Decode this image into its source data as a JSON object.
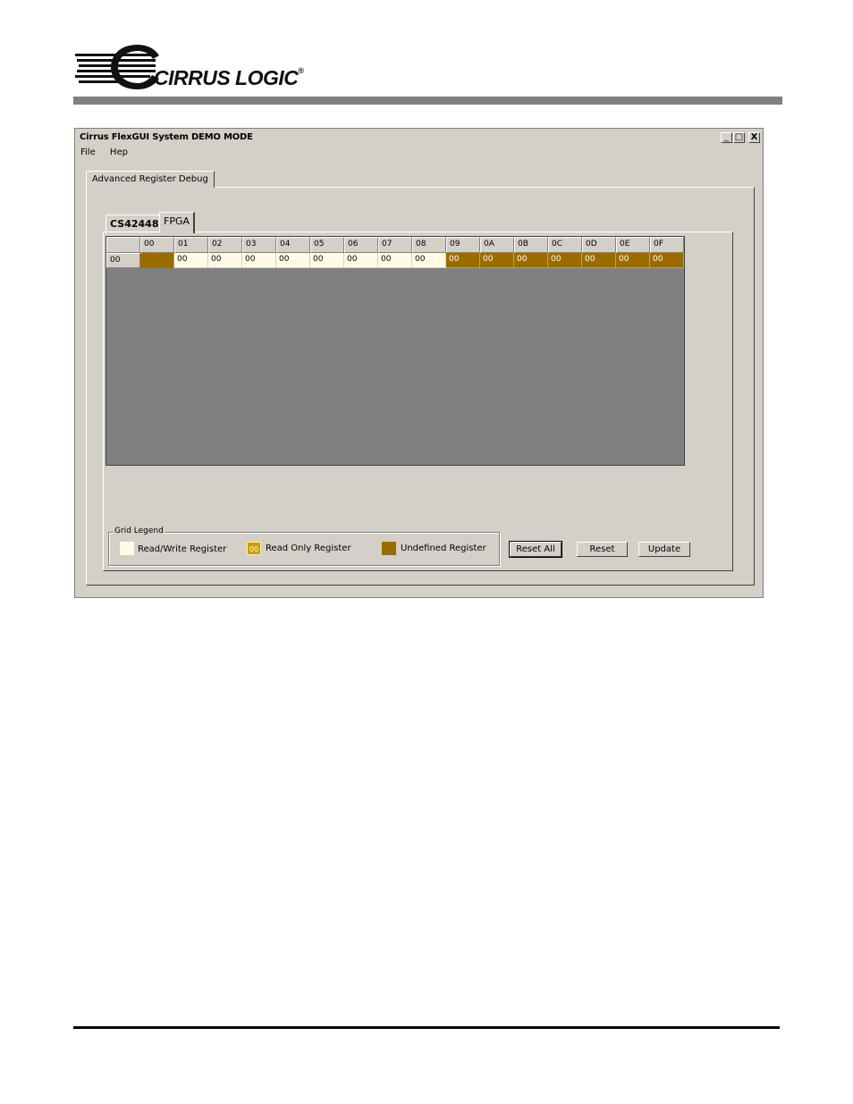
{
  "brand": {
    "name": "CIRRUS LOGIC",
    "reg_mark": "®"
  },
  "window": {
    "title": "Cirrus FlexGUI System DEMO MODE",
    "controls": {
      "minimize": "_",
      "maximize": "□",
      "close": "X"
    }
  },
  "menu": {
    "file": "File",
    "help": "Hep"
  },
  "outer_tab": {
    "label": "Advanced Register Debug"
  },
  "inner_tabs": {
    "tab1": "CS42448",
    "tab2": "FPGA"
  },
  "grid": {
    "columns": [
      "00",
      "01",
      "02",
      "03",
      "04",
      "05",
      "06",
      "07",
      "08",
      "09",
      "0A",
      "0B",
      "0C",
      "0D",
      "0E",
      "0F"
    ],
    "row_header": "00",
    "cells": [
      "",
      "00",
      "00",
      "00",
      "00",
      "00",
      "00",
      "00",
      "00",
      "00",
      "00",
      "00",
      "00",
      "00",
      "00",
      "00"
    ],
    "cell_types": [
      "undefined",
      "rw",
      "rw",
      "rw",
      "rw",
      "rw",
      "rw",
      "rw",
      "rw",
      "ro",
      "ro",
      "ro",
      "ro",
      "ro",
      "ro",
      "ro"
    ]
  },
  "legend": {
    "title": "Grid Legend",
    "rw_label": "Read/Write Register",
    "ro_label": "Read Only Register",
    "ro_swatch": "00",
    "ud_label": "Undefined Register"
  },
  "buttons": {
    "reset_all": "Reset All",
    "reset": "Reset",
    "update": "Update"
  },
  "colors": {
    "read_write": "#fffbe6",
    "read_only": "#9a6c00",
    "undefined": "#9a6c00",
    "grid_bg": "#808080"
  }
}
